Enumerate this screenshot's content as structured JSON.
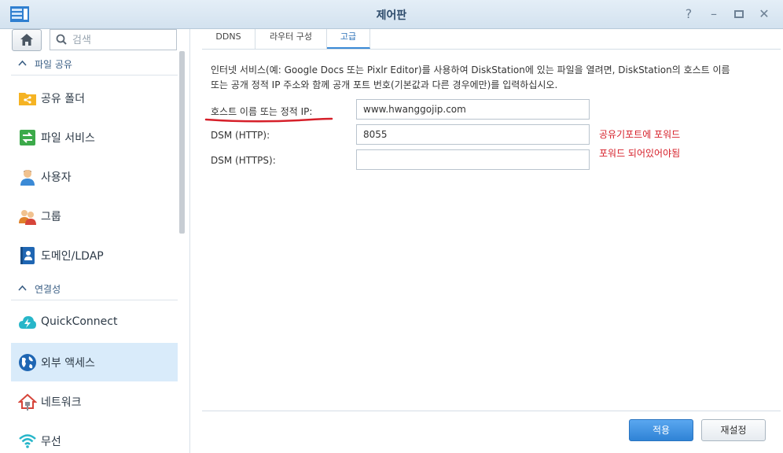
{
  "window": {
    "title": "제어판"
  },
  "sidebar": {
    "search_placeholder": "검색",
    "sections": [
      {
        "label": "파일 공유"
      },
      {
        "label": "연결성"
      }
    ],
    "items": [
      {
        "label": "공유 폴더"
      },
      {
        "label": "파일 서비스"
      },
      {
        "label": "사용자"
      },
      {
        "label": "그룹"
      },
      {
        "label": "도메인/LDAP"
      },
      {
        "label": "QuickConnect"
      },
      {
        "label": "외부 액세스"
      },
      {
        "label": "네트워크"
      },
      {
        "label": "무선"
      }
    ]
  },
  "tabs": [
    {
      "label": "DDNS"
    },
    {
      "label": "라우터 구성"
    },
    {
      "label": "고급"
    }
  ],
  "content": {
    "description_line1": "인터넷 서비스(예: Google Docs 또는 Pixlr Editor)를 사용하여 DiskStation에 있는 파일을 열려면, DiskStation의 호스트 이름",
    "description_line2": "또는 공개 정적 IP 주소와 함께 공개 포트 번호(기본값과 다른 경우에만)를 입력하십시오.",
    "fields": [
      {
        "label": "호스트 이름 또는 정적 IP:",
        "value": "www.hwanggojip.com"
      },
      {
        "label": "DSM (HTTP):",
        "value": "8055"
      },
      {
        "label": "DSM (HTTPS):",
        "value": ""
      }
    ],
    "annotation_line1": "공유기포트에 포워드",
    "annotation_line2": "포워드 되어있어야됨"
  },
  "footer": {
    "apply_label": "적용",
    "reset_label": "재설정"
  },
  "colors": {
    "accent": "#2f83d6",
    "active_item": "#d9ebfa",
    "annotation": "#d6202a"
  }
}
